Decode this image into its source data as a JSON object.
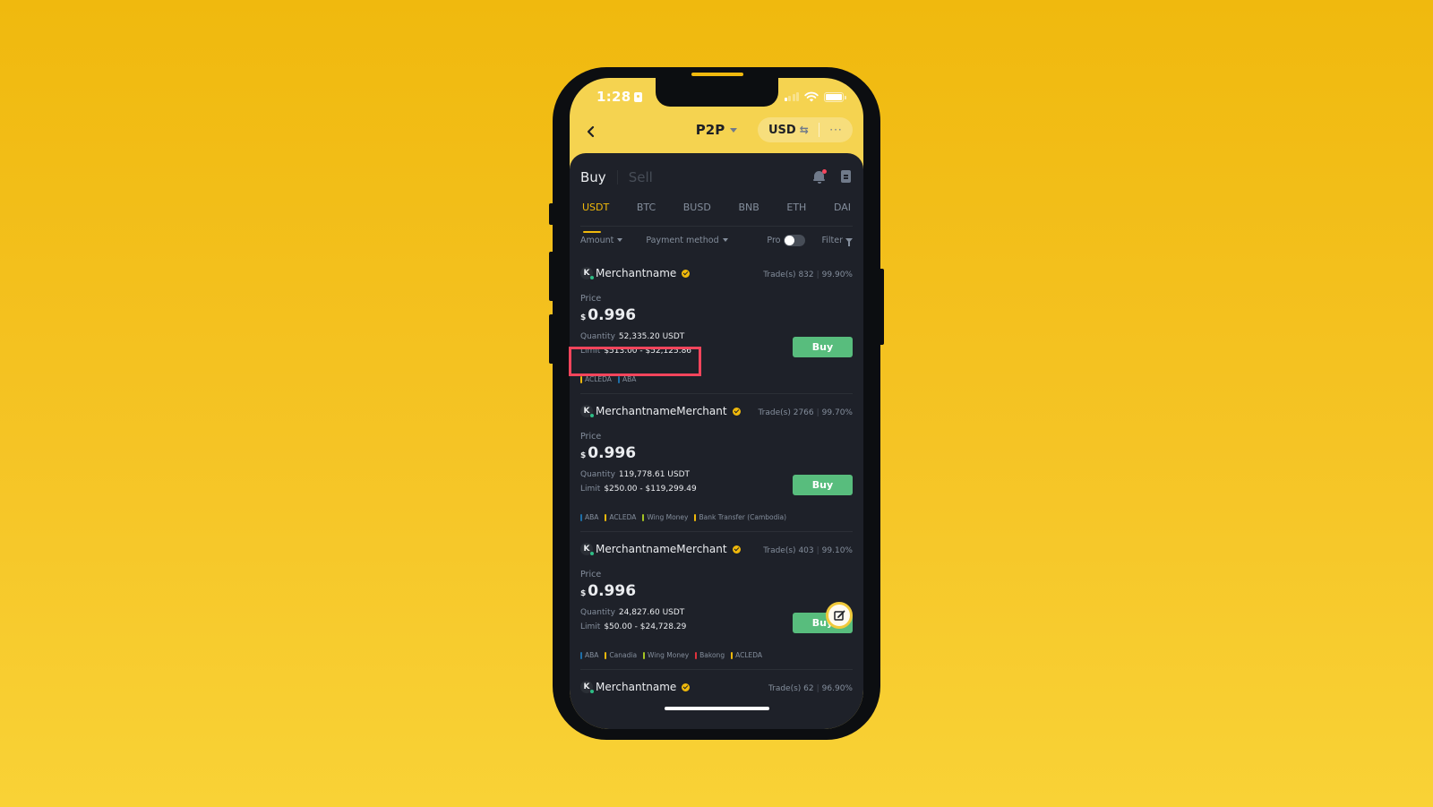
{
  "status_bar": {
    "time": "1:28"
  },
  "nav": {
    "title": "P2P",
    "currency": "USD",
    "swap_icon": "⇆",
    "more_label": "···"
  },
  "trade_tabs": [
    {
      "label": "Buy",
      "active": true
    },
    {
      "label": "Sell",
      "active": false
    }
  ],
  "coin_tabs": [
    {
      "label": "USDT",
      "active": true
    },
    {
      "label": "BTC",
      "active": false
    },
    {
      "label": "BUSD",
      "active": false
    },
    {
      "label": "BNB",
      "active": false
    },
    {
      "label": "ETH",
      "active": false
    },
    {
      "label": "DAI",
      "active": false
    }
  ],
  "filters": {
    "amount": "Amount",
    "payment_method": "Payment method",
    "pro": "Pro",
    "pro_enabled": false,
    "filter": "Filter"
  },
  "ads": [
    {
      "avatar": "K",
      "merchant": "Merchantname",
      "trades_label": "Trade(s)",
      "trades": "832",
      "completion": "99.90%",
      "price_label": "Price",
      "currency_symbol": "$",
      "price": "0.996",
      "quantity_label": "Quantity",
      "quantity": "52,335.20 USDT",
      "limit_label": "Limit",
      "limit": "$513.00 - $52,125.86",
      "button": "Buy",
      "methods": [
        {
          "name": "ACLEDA",
          "color": "#F0B90B"
        },
        {
          "name": "ABA",
          "color": "#1E6FA8"
        }
      ]
    },
    {
      "avatar": "K",
      "merchant": "MerchantnameMerchant",
      "trades_label": "Trade(s)",
      "trades": "2766",
      "completion": "99.70%",
      "price_label": "Price",
      "currency_symbol": "$",
      "price": "0.996",
      "quantity_label": "Quantity",
      "quantity": "119,778.61 USDT",
      "limit_label": "Limit",
      "limit": "$250.00 - $119,299.49",
      "button": "Buy",
      "methods": [
        {
          "name": "ABA",
          "color": "#1E6FA8"
        },
        {
          "name": "ACLEDA",
          "color": "#F0B90B"
        },
        {
          "name": "Wing Money",
          "color": "#A5C422"
        },
        {
          "name": "Bank Transfer (Cambodia)",
          "color": "#F0B90B"
        }
      ]
    },
    {
      "avatar": "K",
      "merchant": "MerchantnameMerchant",
      "trades_label": "Trade(s)",
      "trades": "403",
      "completion": "99.10%",
      "price_label": "Price",
      "currency_symbol": "$",
      "price": "0.996",
      "quantity_label": "Quantity",
      "quantity": "24,827.60 USDT",
      "limit_label": "Limit",
      "limit": "$50.00 - $24,728.29",
      "button": "Buy",
      "methods": [
        {
          "name": "ABA",
          "color": "#1E6FA8"
        },
        {
          "name": "Canadia",
          "color": "#F0B90B"
        },
        {
          "name": "Wing Money",
          "color": "#A5C422"
        },
        {
          "name": "Bakong",
          "color": "#E0323C"
        },
        {
          "name": "ACLEDA",
          "color": "#F0B90B"
        }
      ]
    },
    {
      "avatar": "K",
      "merchant": "Merchantname",
      "trades_label": "Trade(s)",
      "trades": "62",
      "completion": "96.90%"
    }
  ],
  "colors": {
    "accent": "#F0B90B",
    "buy_green": "#58BD7D",
    "highlight": "#F5455C",
    "panel_bg": "#1E2129"
  }
}
